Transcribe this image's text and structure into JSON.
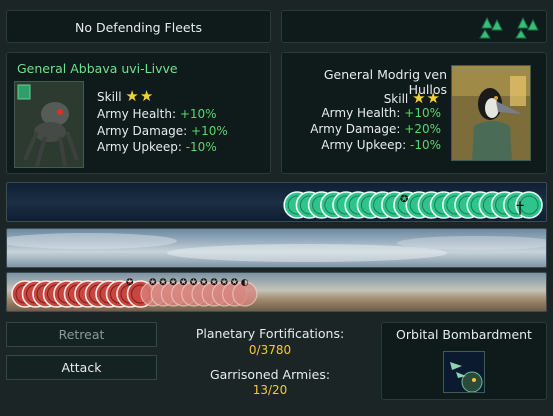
{
  "top": {
    "no_defending_fleets": "No Defending Fleets",
    "fleet_icons": [
      "fleet-icon",
      "fleet-icon"
    ]
  },
  "attacker_general": {
    "name": "General Abbava uvi-Livve",
    "skill_label": "Skill",
    "stars": "★★",
    "army_health_label": "Army Health:",
    "army_health_value": "+10%",
    "army_damage_label": "Army Damage:",
    "army_damage_value": "+10%",
    "army_upkeep_label": "Army Upkeep:",
    "army_upkeep_value": "-10%"
  },
  "defender_general": {
    "name": "General Modrig ven Hullos",
    "skill_label": "Skill",
    "stars": "★★",
    "army_health_label": "Army Health:",
    "army_health_value": "+10%",
    "army_damage_label": "Army Damage:",
    "army_damage_value": "+20%",
    "army_upkeep_label": "Army Upkeep:",
    "army_upkeep_value": "-10%"
  },
  "defender_armies": {
    "count": 20,
    "color": "#2fc48b"
  },
  "attacker_armies": {
    "healthy_count": 12,
    "damaged_count": 10,
    "color": "#c8463f"
  },
  "buttons": {
    "retreat": "Retreat",
    "attack": "Attack"
  },
  "info": {
    "fortifications_label": "Planetary Fortifications:",
    "fortifications_value": "0/3780",
    "garrison_label": "Garrisoned Armies:",
    "garrison_value": "13/20"
  },
  "orbital": {
    "label": "Orbital Bombardment",
    "icon": "bombardment-icon"
  }
}
